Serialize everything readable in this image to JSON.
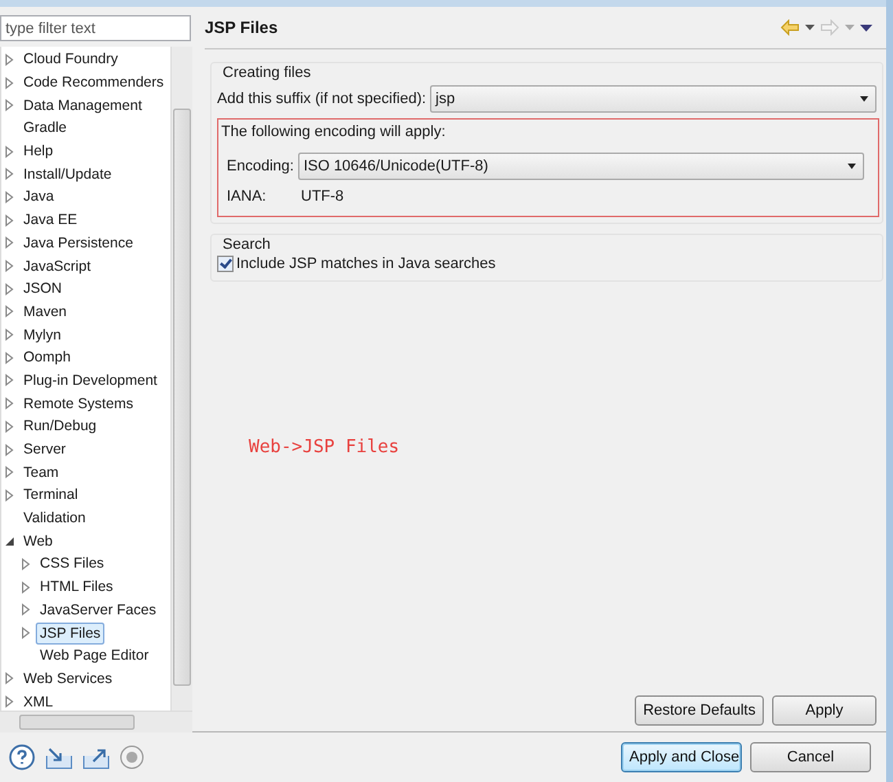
{
  "filter": {
    "placeholder": "type filter text"
  },
  "tree": [
    {
      "label": "Cloud Foundry",
      "expandable": true,
      "expanded": false,
      "selected": false
    },
    {
      "label": "Code Recommenders",
      "expandable": true,
      "expanded": false,
      "selected": false
    },
    {
      "label": "Data Management",
      "expandable": true,
      "expanded": false,
      "selected": false
    },
    {
      "label": "Gradle",
      "expandable": false,
      "selected": false
    },
    {
      "label": "Help",
      "expandable": true,
      "expanded": false,
      "selected": false
    },
    {
      "label": "Install/Update",
      "expandable": true,
      "expanded": false,
      "selected": false
    },
    {
      "label": "Java",
      "expandable": true,
      "expanded": false,
      "selected": false
    },
    {
      "label": "Java EE",
      "expandable": true,
      "expanded": false,
      "selected": false
    },
    {
      "label": "Java Persistence",
      "expandable": true,
      "expanded": false,
      "selected": false
    },
    {
      "label": "JavaScript",
      "expandable": true,
      "expanded": false,
      "selected": false
    },
    {
      "label": "JSON",
      "expandable": true,
      "expanded": false,
      "selected": false
    },
    {
      "label": "Maven",
      "expandable": true,
      "expanded": false,
      "selected": false
    },
    {
      "label": "Mylyn",
      "expandable": true,
      "expanded": false,
      "selected": false
    },
    {
      "label": "Oomph",
      "expandable": true,
      "expanded": false,
      "selected": false
    },
    {
      "label": "Plug-in Development",
      "expandable": true,
      "expanded": false,
      "selected": false
    },
    {
      "label": "Remote Systems",
      "expandable": true,
      "expanded": false,
      "selected": false
    },
    {
      "label": "Run/Debug",
      "expandable": true,
      "expanded": false,
      "selected": false
    },
    {
      "label": "Server",
      "expandable": true,
      "expanded": false,
      "selected": false
    },
    {
      "label": "Team",
      "expandable": true,
      "expanded": false,
      "selected": false
    },
    {
      "label": "Terminal",
      "expandable": true,
      "expanded": false,
      "selected": false
    },
    {
      "label": "Validation",
      "expandable": false,
      "selected": false
    },
    {
      "label": "Web",
      "expandable": true,
      "expanded": true,
      "selected": false,
      "children": [
        {
          "label": "CSS Files",
          "expandable": true,
          "expanded": false,
          "selected": false
        },
        {
          "label": "HTML Files",
          "expandable": true,
          "expanded": false,
          "selected": false
        },
        {
          "label": "JavaServer Faces",
          "expandable": true,
          "expanded": false,
          "selected": false
        },
        {
          "label": "JSP Files",
          "expandable": true,
          "expanded": false,
          "selected": true
        },
        {
          "label": "Web Page Editor",
          "expandable": false,
          "selected": false
        }
      ]
    },
    {
      "label": "Web Services",
      "expandable": true,
      "expanded": false,
      "selected": false
    },
    {
      "label": "XML",
      "expandable": true,
      "expanded": false,
      "selected": false
    }
  ],
  "page_title": "JSP Files",
  "creating_files": {
    "title": "Creating files",
    "suffix_label": "Add this suffix (if not specified):",
    "suffix_value": "jsp",
    "encoding_note": "The following encoding will apply:",
    "encoding_label": "Encoding:",
    "encoding_value": "ISO 10646/Unicode(UTF-8)",
    "iana_label": "IANA:",
    "iana_value": "UTF-8"
  },
  "search": {
    "title": "Search",
    "include_label": "Include JSP matches in Java searches",
    "checked": true
  },
  "annotation": "Web->JSP Files",
  "page_buttons": [
    "Restore Defaults",
    "Apply"
  ],
  "dialog_buttons": [
    {
      "label": "Apply and Close",
      "default": true
    },
    {
      "label": "Cancel",
      "default": false
    }
  ]
}
